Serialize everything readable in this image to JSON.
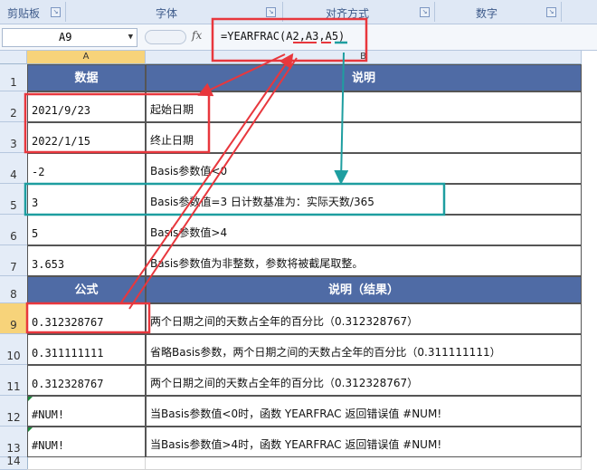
{
  "ribbon": {
    "groups": [
      {
        "label": "剪贴板"
      },
      {
        "label": "字体"
      },
      {
        "label": "对齐方式"
      },
      {
        "label": "数字"
      }
    ]
  },
  "formula_bar": {
    "name_box": "A9",
    "fx": "fx",
    "formula": "=YEARFRAC(A2,A3,A5)"
  },
  "columns": [
    "A",
    "B"
  ],
  "rows": [
    {
      "num": "1",
      "a": "数据",
      "b": "说明",
      "header": true
    },
    {
      "num": "2",
      "a": "2021/9/23",
      "b": "起始日期"
    },
    {
      "num": "3",
      "a": "2022/1/15",
      "b": "终止日期"
    },
    {
      "num": "4",
      "a": "-2",
      "b": "Basis参数值<0"
    },
    {
      "num": "5",
      "a": "3",
      "b": "Basis参数值=3    日计数基准为：实际天数/365"
    },
    {
      "num": "6",
      "a": "5",
      "b": "Basis参数值>4"
    },
    {
      "num": "7",
      "a": "3.653",
      "b": "Basis参数值为非整数，参数将被截尾取整。"
    },
    {
      "num": "8",
      "a": "公式",
      "b": "说明（结果）",
      "header": true
    },
    {
      "num": "9",
      "a": "0.312328767",
      "b": "两个日期之间的天数占全年的百分比（0.312328767）"
    },
    {
      "num": "10",
      "a": "0.311111111",
      "b": "省略Basis参数，两个日期之间的天数占全年的百分比（0.311111111）"
    },
    {
      "num": "11",
      "a": "0.312328767",
      "b": "两个日期之间的天数占全年的百分比（0.312328767）"
    },
    {
      "num": "12",
      "a": "#NUM!",
      "b": "当Basis参数值<0时，函数 YEARFRAC 返回错误值 #NUM!"
    },
    {
      "num": "13",
      "a": "#NUM!",
      "b": "当Basis参数值>4时，函数 YEARFRAC 返回错误值 #NUM!"
    },
    {
      "num": "14",
      "a": "",
      "b": ""
    }
  ],
  "colors": {
    "header_fill": "#4f6ba5",
    "highlight_red": "#e8373d",
    "highlight_teal": "#1e9ea0"
  }
}
